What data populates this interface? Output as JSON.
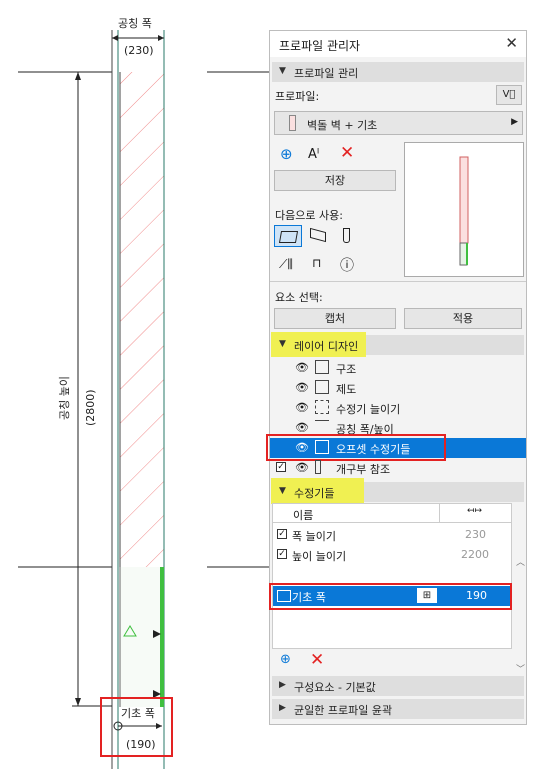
{
  "drawing": {
    "nominal_width_label": "공칭 폭",
    "nominal_width_value": "(230)",
    "nominal_height_label": "공칭 높이",
    "nominal_height_value": "(2800)",
    "footing_width_label": "기초 폭",
    "footing_width_value": "(190)"
  },
  "palette": {
    "title": "프로파일 관리자",
    "close_icon": "close-icon",
    "profile_manage_header": "프로파일 관리",
    "profile_label": "프로파일:",
    "profile_name": "벽돌 벽 + 기초",
    "save_label": "저장",
    "use_as_label": "다음으로 사용:",
    "element_select_label": "요소 선택:",
    "capture_label": "캡처",
    "apply_label": "적용",
    "layer_design_header": "레이어 디자인",
    "layers": [
      {
        "label": "구조",
        "icon": "structure-icon"
      },
      {
        "label": "제도",
        "icon": "drafting-icon"
      },
      {
        "label": "수정기 늘이기",
        "icon": "stretch-icon"
      },
      {
        "label": "공칭 폭/높이",
        "icon": "nominal-size-icon"
      },
      {
        "label": "오프셋 수정기들",
        "icon": "offset-modifier-icon"
      },
      {
        "label": "개구부 참조",
        "icon": "opening-reference-icon"
      }
    ],
    "modifiers_header": "수정기들",
    "table_col_name": "이름",
    "modifiers": [
      {
        "label": "폭 늘이기",
        "value": "230"
      },
      {
        "label": "높이 늘이기",
        "value": "2200"
      }
    ],
    "selected_modifier": {
      "label": "기초 폭",
      "value": "190"
    },
    "component_defaults_header": "구성요소 - 기본값",
    "uniform_outline_header": "균일한 프로파일 윤곽"
  },
  "colors": {
    "accent": "#0a78d7",
    "highlight": "#f0f052",
    "callout_red": "#e32222",
    "modifier_green": "#3fbf3f"
  }
}
